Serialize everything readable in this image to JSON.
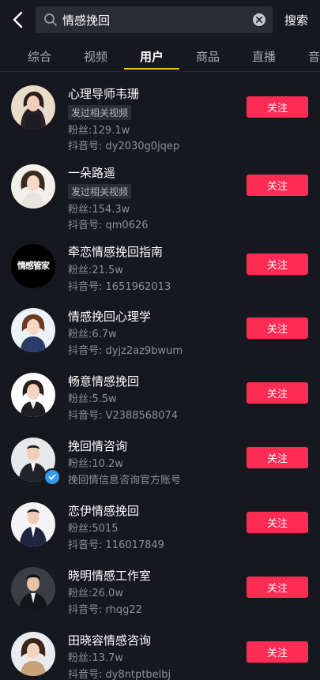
{
  "search": {
    "query": "情感挽回",
    "action_label": "搜索"
  },
  "tabs": [
    {
      "label": "综合"
    },
    {
      "label": "视频"
    },
    {
      "label": "用户"
    },
    {
      "label": "商品"
    },
    {
      "label": "直播"
    },
    {
      "label": "音"
    }
  ],
  "colors": {
    "background": "#16171f",
    "follow_button": "#fe2c55",
    "tab_indicator": "#f5c518",
    "verified_badge": "#2d9bf0"
  },
  "users": [
    {
      "name": "心理导师韦珊",
      "tag": "发过相关视频",
      "fans": "粉丝:129.1w",
      "id_line": "抖音号: dy2030g0jqep",
      "follow_label": "关注",
      "avatar_icon": "woman-portrait"
    },
    {
      "name": "一朵路遥",
      "tag": "发过相关视频",
      "fans": "粉丝:154.3w",
      "id_line": "抖音号: qm0626",
      "follow_label": "关注",
      "avatar_icon": "woman-portrait"
    },
    {
      "name": "牵恋情感挽回指南",
      "fans": "粉丝:21.5w",
      "id_line": "抖音号: 1651962013",
      "follow_label": "关注",
      "avatar_logo_text": "情感管家"
    },
    {
      "name": "情感挽回心理学",
      "fans": "粉丝:6.7w",
      "id_line": "抖音号: dyjz2az9bwum",
      "follow_label": "关注",
      "avatar_icon": "woman-portrait"
    },
    {
      "name": "畅意情感挽回",
      "fans": "粉丝:5.5w",
      "id_line": "抖音号: V2388568074",
      "follow_label": "关注",
      "avatar_icon": "woman-portrait"
    },
    {
      "name": "挽回情咨询",
      "fans": "粉丝:10.2w",
      "id_line": "挽回情信息咨询官方账号",
      "follow_label": "关注",
      "avatar_icon": "man-portrait",
      "verified": true
    },
    {
      "name": "恋伊情感挽回",
      "fans": "粉丝:5015",
      "id_line": "抖音号: 116017849",
      "follow_label": "关注",
      "avatar_icon": "man-portrait"
    },
    {
      "name": "晓明情感工作室",
      "fans": "粉丝:26.0w",
      "id_line": "抖音号: rhqg22",
      "follow_label": "关注",
      "avatar_icon": "man-portrait"
    },
    {
      "name": "田晓容情感咨询",
      "fans": "粉丝:13.7w",
      "id_line": "抖音号: dy8ntptbelbj",
      "follow_label": "关注",
      "avatar_icon": "woman-portrait"
    }
  ]
}
